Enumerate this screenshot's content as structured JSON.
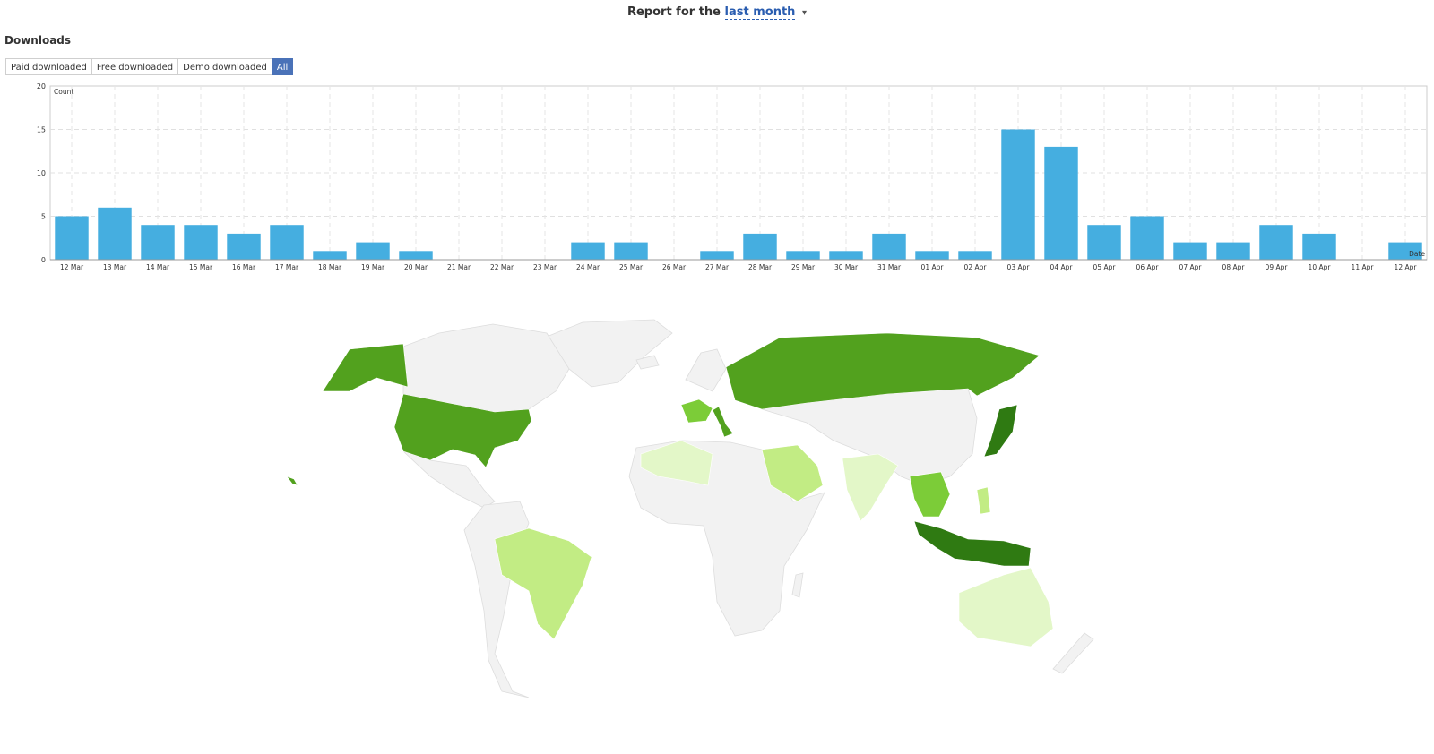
{
  "header": {
    "prefix": "Report for the",
    "period": "last month"
  },
  "section_title": "Downloads",
  "filters": [
    {
      "label": "Paid downloaded",
      "active": false
    },
    {
      "label": "Free downloaded",
      "active": false
    },
    {
      "label": "Demo downloaded",
      "active": false
    },
    {
      "label": "All",
      "active": true
    }
  ],
  "chart_data": {
    "type": "bar",
    "ylabel": "Count",
    "xlabel": "Date",
    "ylim": [
      0,
      20
    ],
    "yticks": [
      0,
      5,
      10,
      15,
      20
    ],
    "grid": true,
    "color": "#45aee0",
    "categories": [
      "12 Mar",
      "13 Mar",
      "14 Mar",
      "15 Mar",
      "16 Mar",
      "17 Mar",
      "18 Mar",
      "19 Mar",
      "20 Mar",
      "21 Mar",
      "22 Mar",
      "23 Mar",
      "24 Mar",
      "25 Mar",
      "26 Mar",
      "27 Mar",
      "28 Mar",
      "29 Mar",
      "30 Mar",
      "31 Mar",
      "01 Apr",
      "02 Apr",
      "03 Apr",
      "04 Apr",
      "05 Apr",
      "06 Apr",
      "07 Apr",
      "08 Apr",
      "09 Apr",
      "10 Apr",
      "11 Apr",
      "12 Apr"
    ],
    "values": [
      5,
      6,
      4,
      4,
      3,
      4,
      1,
      2,
      1,
      0,
      0,
      0,
      2,
      2,
      0,
      1,
      3,
      1,
      1,
      3,
      1,
      1,
      15,
      13,
      4,
      5,
      2,
      2,
      4,
      3,
      0,
      2
    ]
  },
  "map": {
    "colors": {
      "none": "#f2f2f2",
      "level1": "#e3f7c8",
      "level2": "#c2ec84",
      "level3": "#7ccc38",
      "level4": "#52a11e",
      "level5": "#2f7a12"
    }
  }
}
